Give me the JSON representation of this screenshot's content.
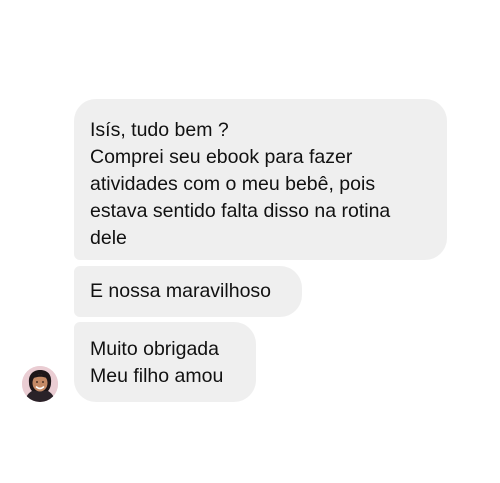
{
  "conversation": {
    "messages": [
      {
        "lines": [
          "Isís, tudo bem ?",
          "Comprei seu ebook para fazer",
          "atividades com o meu bebê, pois",
          "estava sentido falta disso na rotina",
          "dele"
        ]
      },
      {
        "lines": [
          "E nossa maravilhoso"
        ]
      },
      {
        "lines": [
          "Muito obrigada",
          "Meu filho amou"
        ]
      }
    ],
    "sender_avatar": {
      "icon": "user-avatar-icon"
    }
  },
  "colors": {
    "background": "#ffffff",
    "bubble": "#efefef",
    "text": "#111111"
  }
}
